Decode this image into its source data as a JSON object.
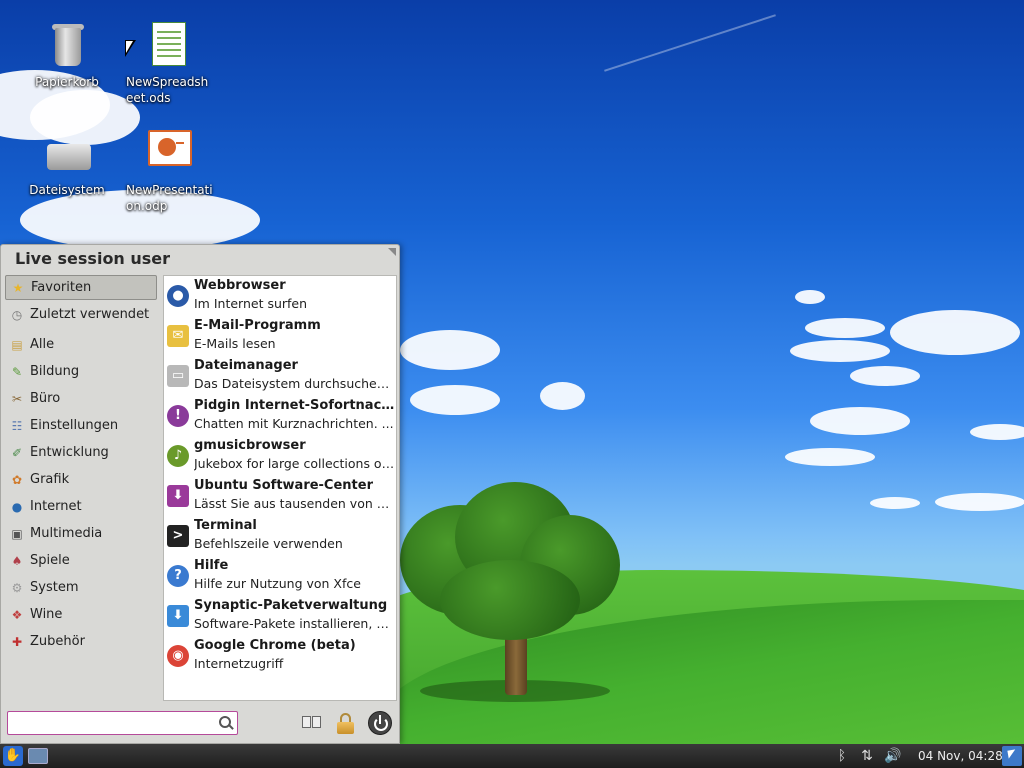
{
  "desktop": {
    "icons": [
      {
        "label": "Papierkorb",
        "icon": "trash-icon"
      },
      {
        "label": "NewSpreadsheet.ods",
        "icon": "spreadsheet-file-icon"
      },
      {
        "label": "Dateisystem",
        "icon": "drive-icon"
      },
      {
        "label": "NewPresentation.odp",
        "icon": "presentation-file-icon"
      }
    ]
  },
  "menu": {
    "user": "Live session user",
    "categories": [
      {
        "label": "Favoriten",
        "icon": "star-icon",
        "color": "#e8b52a"
      },
      {
        "label": "Zuletzt verwendet",
        "icon": "clock-icon",
        "color": "#777777"
      },
      {
        "label": "Alle",
        "icon": "folder-icon",
        "color": "#c9a24a"
      },
      {
        "label": "Bildung",
        "icon": "education-icon",
        "color": "#5a9a3a"
      },
      {
        "label": "Büro",
        "icon": "office-icon",
        "color": "#8a6a3a"
      },
      {
        "label": "Einstellungen",
        "icon": "settings-icon",
        "color": "#5a7ab0"
      },
      {
        "label": "Entwicklung",
        "icon": "development-icon",
        "color": "#4a8a4a"
      },
      {
        "label": "Grafik",
        "icon": "graphics-icon",
        "color": "#d07a2a"
      },
      {
        "label": "Internet",
        "icon": "globe-icon",
        "color": "#2a6ab0"
      },
      {
        "label": "Multimedia",
        "icon": "multimedia-icon",
        "color": "#555555"
      },
      {
        "label": "Spiele",
        "icon": "games-icon",
        "color": "#b0404a"
      },
      {
        "label": "System",
        "icon": "system-icon",
        "color": "#9a9a9a"
      },
      {
        "label": "Wine",
        "icon": "wine-icon",
        "color": "#c04040"
      },
      {
        "label": "Zubehör",
        "icon": "accessories-icon",
        "color": "#c03030"
      }
    ],
    "apps": [
      {
        "name": "Webbrowser",
        "desc": "Im Internet surfen",
        "icon": "globe-icon",
        "color": "#2a5aa8"
      },
      {
        "name": "E-Mail-Programm",
        "desc": "E-Mails lesen",
        "icon": "mail-icon",
        "color": "#e8c040"
      },
      {
        "name": "Dateimanager",
        "desc": "Das Dateisystem durchsuchen, ...",
        "icon": "file-manager-icon",
        "color": "#b8b8b8"
      },
      {
        "name": "Pidgin Internet-Sofortnachri...",
        "desc": "Chatten mit Kurznachrichten. ...",
        "icon": "pidgin-icon",
        "color": "#8a3a9a"
      },
      {
        "name": "gmusicbrowser",
        "desc": "Jukebox for large collections of ...",
        "icon": "music-icon",
        "color": "#6a9a2a"
      },
      {
        "name": "Ubuntu Software-Center",
        "desc": "Lässt Sie aus tausenden von An...",
        "icon": "software-center-icon",
        "color": "#9a3a9a"
      },
      {
        "name": "Terminal",
        "desc": "Befehlszeile verwenden",
        "icon": "terminal-icon",
        "color": "#222222"
      },
      {
        "name": "Hilfe",
        "desc": "Hilfe zur Nutzung von Xfce",
        "icon": "help-icon",
        "color": "#3a7ad0"
      },
      {
        "name": "Synaptic-Paketverwaltung",
        "desc": "Software-Pakete installieren, en...",
        "icon": "synaptic-icon",
        "color": "#3a8ad8"
      },
      {
        "name": "Google Chrome (beta)",
        "desc": "Internetzugriff",
        "icon": "chrome-icon",
        "color": "#db4437"
      }
    ],
    "search": {
      "value": "",
      "placeholder": ""
    }
  },
  "taskbar": {
    "clock": "04 Nov, 04:28",
    "tray": [
      {
        "icon": "bluetooth-icon",
        "glyph": "ᛒ"
      },
      {
        "icon": "network-icon",
        "glyph": "⇅"
      },
      {
        "icon": "volume-icon",
        "glyph": "🔊"
      }
    ]
  }
}
